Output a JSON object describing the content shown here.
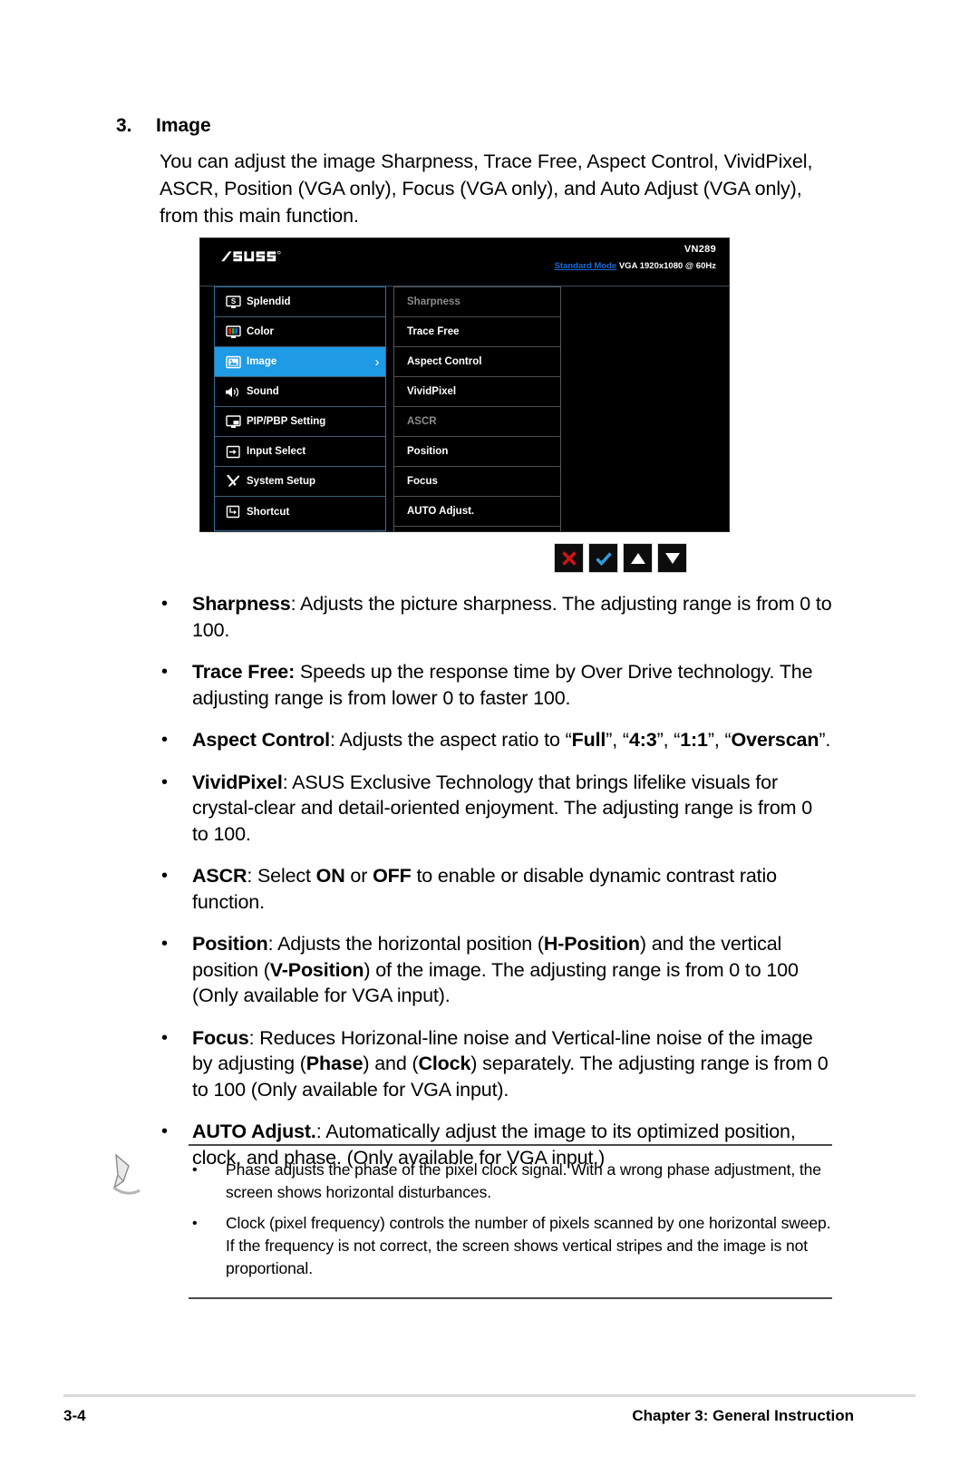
{
  "section": {
    "number": "3.",
    "title": "Image",
    "intro": "You can adjust the image Sharpness, Trace Free, Aspect Control, VividPixel, ASCR, Position (VGA only), Focus (VGA only), and Auto Adjust (VGA only),  from this main function."
  },
  "osd": {
    "model": "VN289",
    "mode_highlight": "Standard Mode",
    "mode_rest": "VGA  1920x1080 @ 60Hz",
    "brand": "ASUS",
    "accent_color": "#1f9ae4",
    "mode_color": "#1a6bd6",
    "main_menu": [
      {
        "label": "Splendid",
        "icon": "splendid-icon",
        "selected": false
      },
      {
        "label": "Color",
        "icon": "color-icon",
        "selected": false
      },
      {
        "label": "Image",
        "icon": "image-icon",
        "selected": true
      },
      {
        "label": "Sound",
        "icon": "sound-icon",
        "selected": false
      },
      {
        "label": "PIP/PBP Setting",
        "icon": "pip-pbp-icon",
        "selected": false
      },
      {
        "label": "Input Select",
        "icon": "input-select-icon",
        "selected": false
      },
      {
        "label": "System Setup",
        "icon": "system-setup-icon",
        "selected": false
      },
      {
        "label": "Shortcut",
        "icon": "shortcut-icon",
        "selected": false
      }
    ],
    "sub_menu": [
      {
        "label": "Sharpness",
        "dimmed": true
      },
      {
        "label": "Trace Free",
        "dimmed": false
      },
      {
        "label": "Aspect Control",
        "dimmed": false
      },
      {
        "label": "VividPixel",
        "dimmed": false
      },
      {
        "label": "ASCR",
        "dimmed": true
      },
      {
        "label": "Position",
        "dimmed": false
      },
      {
        "label": "Focus",
        "dimmed": false
      },
      {
        "label": "AUTO Adjust.",
        "dimmed": false
      }
    ],
    "buttons": [
      {
        "name": "close-icon",
        "color": "#cc1414"
      },
      {
        "name": "check-icon",
        "color": "#2f9fe0"
      },
      {
        "name": "up-arrow-icon",
        "color": "#ffffff"
      },
      {
        "name": "down-arrow-icon",
        "color": "#ffffff"
      }
    ]
  },
  "bullets": [
    {
      "bullet": "•",
      "parts": [
        {
          "text": "Sharpness",
          "bold": true
        },
        {
          "text": ": Adjusts the picture sharpness. The adjusting range is from 0 to 100.",
          "bold": false
        }
      ]
    },
    {
      "bullet": "•",
      "parts": [
        {
          "text": "Trace Free:",
          "bold": true
        },
        {
          "text": " Speeds up the response time by Over Drive technology. The adjusting range is from lower 0 to faster 100.",
          "bold": false
        }
      ]
    },
    {
      "bullet": "•",
      "parts": [
        {
          "text": "Aspect Control",
          "bold": true
        },
        {
          "text": ": Adjusts the aspect ratio to “",
          "bold": false
        },
        {
          "text": "Full",
          "bold": true
        },
        {
          "text": "”, “",
          "bold": false
        },
        {
          "text": "4:3",
          "bold": true
        },
        {
          "text": "”, “",
          "bold": false
        },
        {
          "text": "1:1",
          "bold": true
        },
        {
          "text": "”, “",
          "bold": false
        },
        {
          "text": "Overscan",
          "bold": true
        },
        {
          "text": "”.",
          "bold": false
        }
      ]
    },
    {
      "bullet": "•",
      "parts": [
        {
          "text": "VividPixel",
          "bold": true
        },
        {
          "text": ": ASUS Exclusive Technology that brings lifelike visuals for crystal-clear and detail-oriented enjoyment. The adjusting range is from 0 to 100.",
          "bold": false
        }
      ]
    },
    {
      "bullet": "•",
      "parts": [
        {
          "text": "ASCR",
          "bold": true
        },
        {
          "text": ": Select ",
          "bold": false
        },
        {
          "text": "ON",
          "bold": true
        },
        {
          "text": " or ",
          "bold": false
        },
        {
          "text": "OFF",
          "bold": true
        },
        {
          "text": " to enable or disable dynamic contrast ratio function.",
          "bold": false
        }
      ]
    },
    {
      "bullet": "•",
      "parts": [
        {
          "text": "Position",
          "bold": true
        },
        {
          "text": ": Adjusts the horizontal position (",
          "bold": false
        },
        {
          "text": "H-Position",
          "bold": true
        },
        {
          "text": ") and the vertical position (",
          "bold": false
        },
        {
          "text": "V-Position",
          "bold": true
        },
        {
          "text": ") of the image. The adjusting range is from 0 to 100 (Only available for VGA input).",
          "bold": false
        }
      ]
    },
    {
      "bullet": "•",
      "parts": [
        {
          "text": "Focus",
          "bold": true
        },
        {
          "text": ": Reduces Horizonal-line noise and Vertical-line noise of the image by adjusting (",
          "bold": false
        },
        {
          "text": "Phase",
          "bold": true
        },
        {
          "text": ") and (",
          "bold": false
        },
        {
          "text": "Clock",
          "bold": true
        },
        {
          "text": ") separately. The adjusting range is from 0 to 100 (Only available for VGA input).",
          "bold": false
        }
      ]
    },
    {
      "bullet": "•",
      "parts": [
        {
          "text": "AUTO Adjust.",
          "bold": true
        },
        {
          "text": ": Automatically adjust the image to its optimized position, clock, and phase. (Only available for VGA input.)",
          "bold": false
        }
      ]
    }
  ],
  "note": {
    "icon": "pencil-note-icon",
    "items": [
      {
        "bullet": "•",
        "text": "Phase adjusts the phase of the pixel clock signal. With a wrong phase adjustment, the screen shows horizontal disturbances."
      },
      {
        "bullet": "•",
        "text": "Clock (pixel frequency) controls the number of pixels scanned by one horizontal sweep. If the frequency is not correct, the screen shows vertical stripes and the image is not proportional."
      }
    ]
  },
  "footer": {
    "page": "3-4",
    "chapter": "Chapter 3: General Instruction"
  }
}
